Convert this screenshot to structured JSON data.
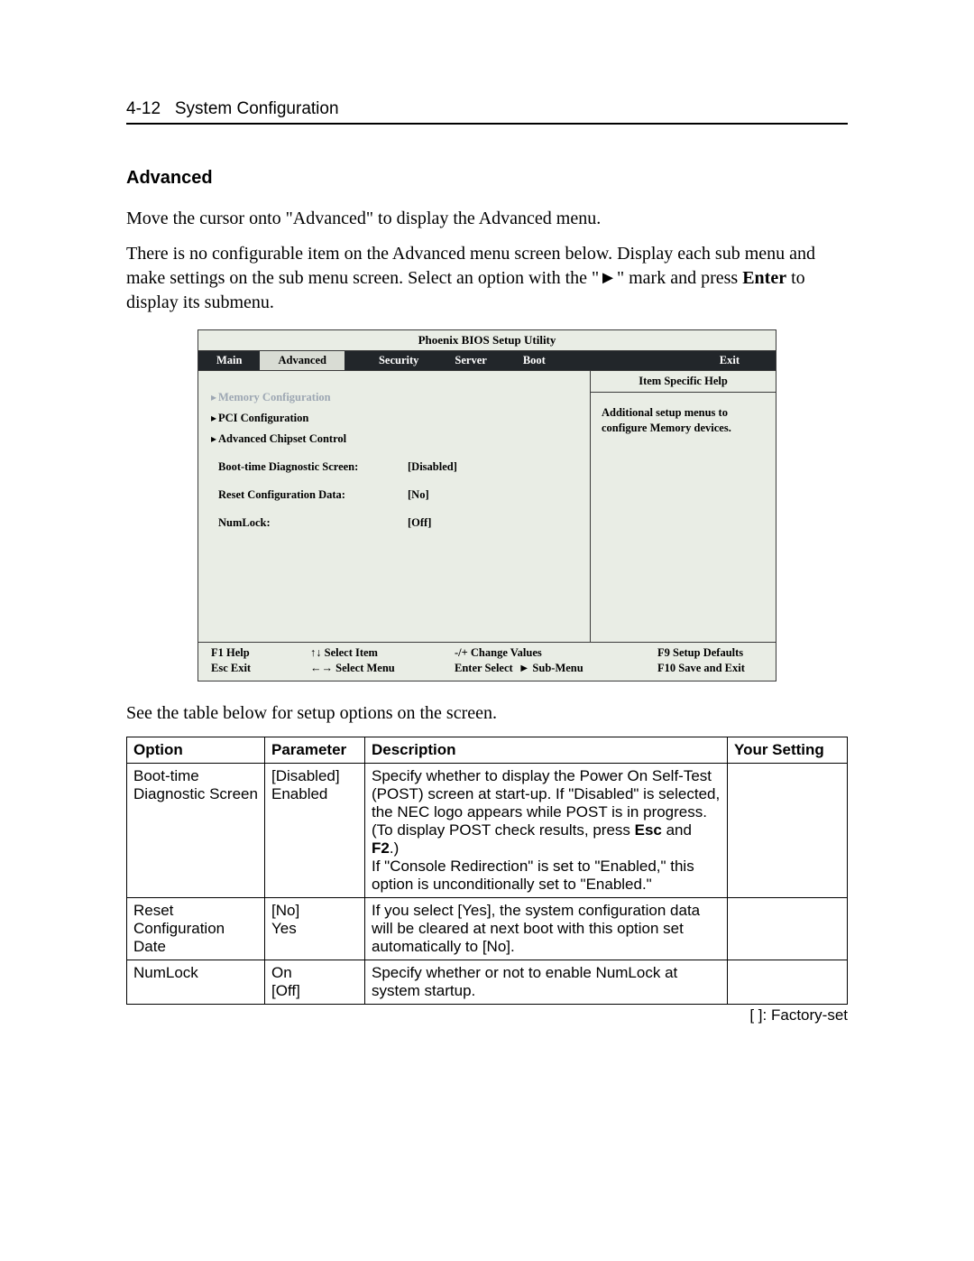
{
  "header": {
    "page_number": "4-12",
    "page_title": "System Configuration"
  },
  "section": {
    "title": "Advanced",
    "para1": "Move the cursor onto \"Advanced\" to display the Advanced menu.",
    "para2_a": "There is no configurable item on the Advanced menu screen below. Display each sub menu and make settings on the sub menu screen. Select an option with the \"►\" mark and press ",
    "para2_b": "Enter",
    "para2_c": " to display its submenu."
  },
  "bios": {
    "title": "Phoenix BIOS Setup Utility",
    "tabs": [
      "Main",
      "Advanced",
      "Security",
      "Server",
      "Boot",
      "Exit"
    ],
    "active_tab": "Advanced",
    "items": {
      "memory_config": "Memory Configuration",
      "pci_config": "PCI Configuration",
      "adv_chipset": "Advanced Chipset Control",
      "boot_diag_label": "Boot-time Diagnostic Screen:",
      "boot_diag_value": "[Disabled]",
      "reset_conf_label": "Reset Configuration Data:",
      "reset_conf_value": "[No]",
      "numlock_label": "NumLock:",
      "numlock_value": "[Off]"
    },
    "help": {
      "title": "Item Specific Help",
      "text": "Additional setup menus to configure Memory devices."
    },
    "footer": {
      "f1": "F1  Help",
      "f1b": "Esc Exit",
      "f2a": "↑↓  Select Item",
      "f2b": "←→ Select Menu",
      "f3a": "-/+     Change Values",
      "f3b": "Enter Select   ",
      "f3b2": "► Sub-Menu",
      "f4a": "F9  Setup Defaults",
      "f4b": "F10 Save and Exit"
    }
  },
  "after_bios": "See the table below for setup options on the screen.",
  "table": {
    "headers": [
      "Option",
      "Parameter",
      "Description",
      "Your Setting"
    ],
    "rows": [
      {
        "option": "Boot-time\nDiagnostic Screen",
        "parameter": "[Disabled]\nEnabled",
        "desc_a": "Specify whether to display the Power On Self-Test (POST) screen at start-up. If \"Disabled\" is selected, the NEC logo appears while POST is in progress. (To display POST check results, press ",
        "desc_b": "Esc",
        "desc_c": " and ",
        "desc_d": "F2",
        "desc_e": ".)\nIf \"Console Redirection\" is set to \"Enabled,\" this option is unconditionally set to \"Enabled.\"",
        "setting": ""
      },
      {
        "option": "Reset\nConfiguration Date",
        "parameter": "[No]\nYes",
        "desc_plain": "If you select [Yes], the system configuration data will be cleared at next boot with this option set automatically to [No].",
        "setting": ""
      },
      {
        "option": "NumLock",
        "parameter": "On\n[Off]",
        "desc_plain": "Specify whether or not to enable NumLock at system startup.",
        "setting": ""
      }
    ]
  },
  "factory_note": "[      ]:  Factory-set"
}
